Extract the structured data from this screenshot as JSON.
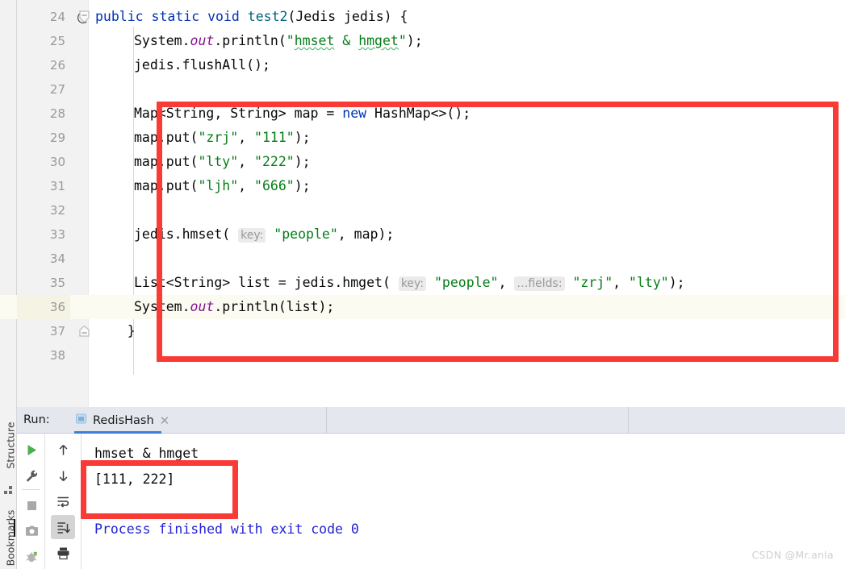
{
  "editor": {
    "language": "java",
    "gutter_annotation_icon": "at-annotation-icon",
    "current_line": 36,
    "lines": [
      {
        "num": "24",
        "indent": 0,
        "gmark": "@",
        "fold": "collapse",
        "tokens": [
          {
            "t": "public ",
            "c": "kw"
          },
          {
            "t": "static ",
            "c": "kw"
          },
          {
            "t": "void ",
            "c": "kw"
          },
          {
            "t": "test2",
            "c": "meth"
          },
          {
            "t": "(Jedis jedis) {",
            "c": "plain"
          }
        ]
      },
      {
        "num": "25",
        "indent": 1,
        "gmark": "",
        "fold": "",
        "tokens": [
          {
            "t": "System.",
            "c": "plain"
          },
          {
            "t": "out",
            "c": "field"
          },
          {
            "t": ".println(",
            "c": "plain"
          },
          {
            "t": "\"",
            "c": "str"
          },
          {
            "t": "hmset",
            "c": "str typo"
          },
          {
            "t": " & ",
            "c": "str"
          },
          {
            "t": "hmget",
            "c": "str typo"
          },
          {
            "t": "\"",
            "c": "str"
          },
          {
            "t": ");",
            "c": "plain"
          }
        ]
      },
      {
        "num": "26",
        "indent": 1,
        "gmark": "",
        "fold": "",
        "tokens": [
          {
            "t": "jedis.flushAll();",
            "c": "plain"
          }
        ]
      },
      {
        "num": "27",
        "indent": 0,
        "gmark": "",
        "fold": "",
        "tokens": []
      },
      {
        "num": "28",
        "indent": 1,
        "gmark": "",
        "fold": "",
        "tokens": [
          {
            "t": "Map<String, String> map = ",
            "c": "plain"
          },
          {
            "t": "new ",
            "c": "kw"
          },
          {
            "t": "HashMap<>();",
            "c": "plain"
          }
        ]
      },
      {
        "num": "29",
        "indent": 1,
        "gmark": "",
        "fold": "",
        "tokens": [
          {
            "t": "map.put(",
            "c": "plain"
          },
          {
            "t": "\"zrj\"",
            "c": "str"
          },
          {
            "t": ", ",
            "c": "plain"
          },
          {
            "t": "\"111\"",
            "c": "str"
          },
          {
            "t": ");",
            "c": "plain"
          }
        ]
      },
      {
        "num": "30",
        "indent": 1,
        "gmark": "",
        "fold": "",
        "tokens": [
          {
            "t": "map.put(",
            "c": "plain"
          },
          {
            "t": "\"lty\"",
            "c": "str"
          },
          {
            "t": ", ",
            "c": "plain"
          },
          {
            "t": "\"222\"",
            "c": "str"
          },
          {
            "t": ");",
            "c": "plain"
          }
        ]
      },
      {
        "num": "31",
        "indent": 1,
        "gmark": "",
        "fold": "",
        "tokens": [
          {
            "t": "map.put(",
            "c": "plain"
          },
          {
            "t": "\"ljh\"",
            "c": "str"
          },
          {
            "t": ", ",
            "c": "plain"
          },
          {
            "t": "\"666\"",
            "c": "str"
          },
          {
            "t": ");",
            "c": "plain"
          }
        ]
      },
      {
        "num": "32",
        "indent": 0,
        "gmark": "",
        "fold": "",
        "tokens": []
      },
      {
        "num": "33",
        "indent": 1,
        "gmark": "",
        "fold": "",
        "tokens": [
          {
            "t": "jedis.hmset( ",
            "c": "plain"
          },
          {
            "t": "key:",
            "c": "hint"
          },
          {
            "t": " ",
            "c": "plain"
          },
          {
            "t": "\"people\"",
            "c": "str"
          },
          {
            "t": ", map);",
            "c": "plain"
          }
        ]
      },
      {
        "num": "34",
        "indent": 0,
        "gmark": "",
        "fold": "",
        "tokens": []
      },
      {
        "num": "35",
        "indent": 1,
        "gmark": "",
        "fold": "",
        "tokens": [
          {
            "t": "List<String> list = jedis.hmget( ",
            "c": "plain"
          },
          {
            "t": "key:",
            "c": "hint"
          },
          {
            "t": " ",
            "c": "plain"
          },
          {
            "t": "\"people\"",
            "c": "str"
          },
          {
            "t": ", ",
            "c": "plain"
          },
          {
            "t": "…fields:",
            "c": "hint"
          },
          {
            "t": " ",
            "c": "plain"
          },
          {
            "t": "\"zrj\"",
            "c": "str"
          },
          {
            "t": ", ",
            "c": "plain"
          },
          {
            "t": "\"lty\"",
            "c": "str"
          },
          {
            "t": ");",
            "c": "plain"
          }
        ]
      },
      {
        "num": "36",
        "indent": 1,
        "gmark": "",
        "fold": "",
        "tokens": [
          {
            "t": "System.",
            "c": "plain"
          },
          {
            "t": "out",
            "c": "field"
          },
          {
            "t": ".println(list);",
            "c": "plain"
          }
        ]
      },
      {
        "num": "37",
        "indent": 0,
        "gmark": "",
        "fold": "expand",
        "tokens": [
          {
            "t": "    }",
            "c": "plain"
          }
        ]
      },
      {
        "num": "38",
        "indent": 0,
        "gmark": "",
        "fold": "",
        "tokens": []
      }
    ]
  },
  "annotations": {
    "code_box_color": "#f93a35",
    "output_box_color": "#f93a35"
  },
  "tool_rail": {
    "structure_label": "Structure",
    "bookmarks_label": "Bookmarks"
  },
  "run_panel": {
    "run_label": "Run:",
    "tab_name": "RedisHash",
    "tab_icon": "run-configuration-icon",
    "close_icon": "close-icon",
    "toolbar_left": [
      {
        "name": "rerun-button",
        "icon": "play-icon"
      },
      {
        "name": "settings-button",
        "icon": "wrench-icon"
      },
      {
        "name": "stop-button",
        "icon": "stop-square-icon"
      },
      {
        "name": "screenshot-button",
        "icon": "camera-icon"
      },
      {
        "name": "debug-button",
        "icon": "bug-icon"
      }
    ],
    "toolbar_right": [
      {
        "name": "prev-occurrence-button",
        "icon": "arrow-up-icon",
        "selected": false
      },
      {
        "name": "next-occurrence-button",
        "icon": "arrow-down-icon",
        "selected": false
      },
      {
        "name": "soft-wrap-button",
        "icon": "soft-wrap-icon",
        "selected": false
      },
      {
        "name": "scroll-to-end-button",
        "icon": "scroll-to-end-icon",
        "selected": true
      },
      {
        "name": "print-button",
        "icon": "printer-icon",
        "selected": false
      }
    ],
    "console": {
      "lines": [
        {
          "text": "hmset & hmget",
          "color": "black"
        },
        {
          "text": "[111, 222]",
          "color": "black"
        },
        {
          "text": "Process finished with exit code 0",
          "color": "blue"
        }
      ]
    }
  },
  "watermark": {
    "text": "CSDN @Mr.anla"
  }
}
